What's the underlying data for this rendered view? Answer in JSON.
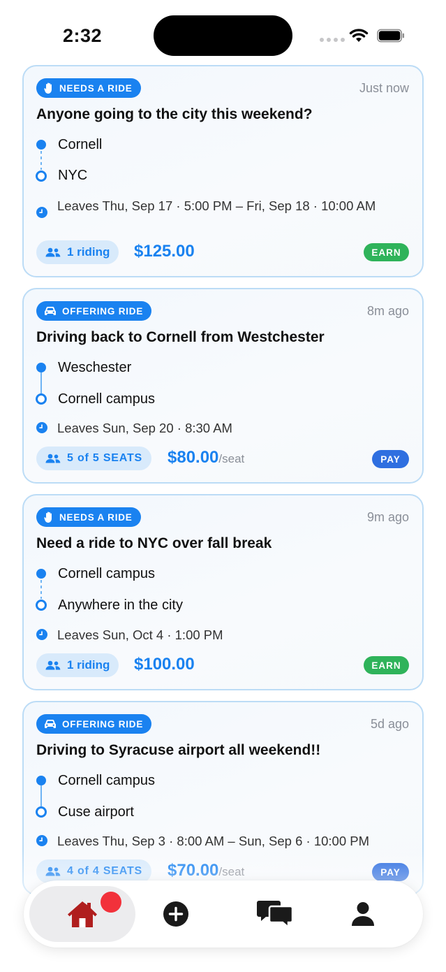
{
  "status_bar": {
    "time": "2:32"
  },
  "posts": [
    {
      "type_label": "NEEDS A RIDE",
      "type_icon": "raised-hand-icon",
      "time_ago": "Just now",
      "title": "Anyone going to the city this weekend?",
      "from": "Cornell",
      "to": "NYC",
      "route_style": "dashed",
      "leaves": "Leaves Thu, Sep 17 · 5:00 PM – Fri, Sep 18 · 10:00 AM",
      "count_label": "1 riding",
      "price": "$125.00",
      "price_unit": "",
      "action_tag": "EARN"
    },
    {
      "type_label": "OFFERING RIDE",
      "type_icon": "car-icon",
      "time_ago": "8m ago",
      "title": "Driving back to Cornell from Westchester",
      "from": "Weschester",
      "to": "Cornell campus",
      "route_style": "solid",
      "leaves": "Leaves Sun, Sep 20 · 8:30 AM",
      "count_label": "5 of 5 SEATS",
      "price": "$80.00",
      "price_unit": "/seat",
      "action_tag": "PAY"
    },
    {
      "type_label": "NEEDS A RIDE",
      "type_icon": "raised-hand-icon",
      "time_ago": "9m ago",
      "title": "Need a ride to NYC over fall break",
      "from": "Cornell campus",
      "to": "Anywhere in the city",
      "route_style": "dashed",
      "leaves": "Leaves Sun, Oct 4 · 1:00 PM",
      "count_label": "1 riding",
      "price": "$100.00",
      "price_unit": "",
      "action_tag": "EARN"
    },
    {
      "type_label": "OFFERING RIDE",
      "type_icon": "car-icon",
      "time_ago": "5d ago",
      "title": "Driving to Syracuse airport all weekend!!",
      "from": "Cornell campus",
      "to": "Cuse airport",
      "route_style": "solid",
      "leaves": "Leaves Thu, Sep 3 · 8:00 AM – Sun, Sep 6 · 10:00 PM",
      "count_label": "4 of 4 SEATS",
      "price": "$70.00",
      "price_unit": "/seat",
      "action_tag": "PAY"
    }
  ],
  "tab_bar": {
    "items": [
      "home-icon",
      "add-icon",
      "chat-bubbles-icon",
      "person-icon"
    ],
    "active": "home"
  },
  "colors": {
    "accent": "#1a82f0",
    "earn": "#2fb35a",
    "pay": "#2f6fe0",
    "notification": "#f2313b",
    "home_icon": "#b01e1e"
  }
}
